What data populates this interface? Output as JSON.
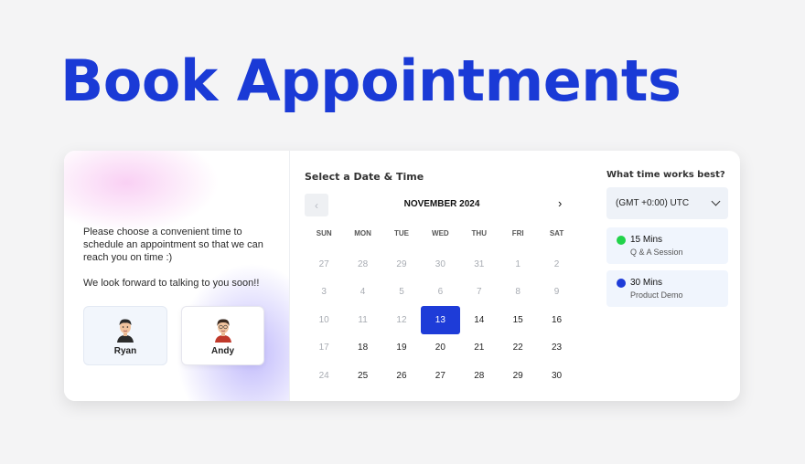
{
  "headline": "Book Appointments",
  "intro": {
    "line1": "Please choose a convenient time to schedule an appointment so that we can reach you on time :)",
    "line2": "We look forward to talking to you soon!!"
  },
  "people": [
    {
      "name": "Ryan"
    },
    {
      "name": "Andy"
    }
  ],
  "calendar": {
    "section_title": "Select a Date & Time",
    "month_label": "NOVEMBER 2024",
    "prev_icon": "‹",
    "next_icon": "›",
    "weekdays": [
      "SUN",
      "MON",
      "TUE",
      "WED",
      "THU",
      "FRI",
      "SAT"
    ],
    "weeks": [
      [
        "27",
        "28",
        "29",
        "30",
        "31",
        "1",
        "2"
      ],
      [
        "3",
        "4",
        "5",
        "6",
        "7",
        "8",
        "9"
      ],
      [
        "10",
        "11",
        "12",
        "13",
        "14",
        "15",
        "16"
      ],
      [
        "17",
        "18",
        "19",
        "20",
        "21",
        "22",
        "23"
      ],
      [
        "24",
        "25",
        "26",
        "27",
        "28",
        "29",
        "30"
      ]
    ],
    "selected_day": "13"
  },
  "time": {
    "title": "What time works best?",
    "timezone": "(GMT +0:00) UTC",
    "options": [
      {
        "duration": "15 Mins",
        "label": "Q & A Session",
        "color": "#22d34a"
      },
      {
        "duration": "30 Mins",
        "label": "Product Demo",
        "color": "#1e3cd8"
      }
    ]
  },
  "colors": {
    "accent": "#1e3cd8",
    "headline": "#1a3ad6"
  }
}
